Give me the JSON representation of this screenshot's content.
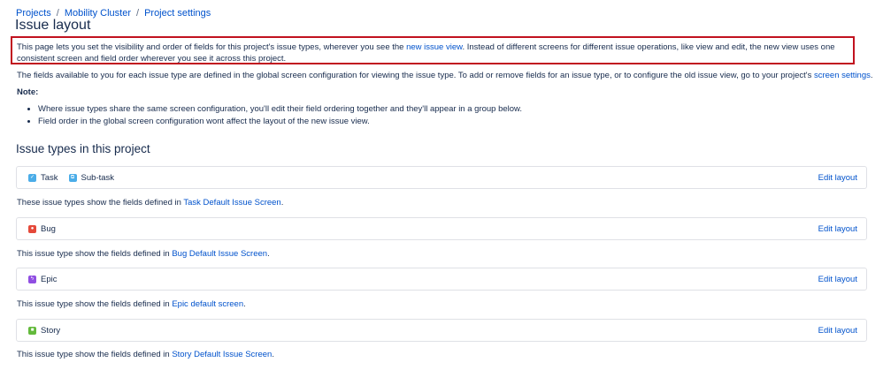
{
  "breadcrumb": {
    "items": [
      "Projects",
      "Mobility Cluster",
      "Project settings"
    ],
    "separator": "/"
  },
  "page_title": "Issue layout",
  "intro": {
    "text_before": "This page lets you set the visibility and order of fields for this project's issue types, wherever you see the ",
    "link": "new issue view",
    "text_after": ". Instead of different screens for different issue operations, like view and edit, the new view uses one consistent screen and field order wherever you see it across this project."
  },
  "fields_para": {
    "text_before": "The fields available to you for each issue type are defined in the global screen configuration for viewing the issue type. To add or remove fields for an issue type, or to configure the old issue view, go to your project's ",
    "link": "screen settings",
    "text_after": "."
  },
  "note_label": "Note:",
  "notes": [
    "Where issue types share the same screen configuration, you'll edit their field ordering together and they'll appear in a group below.",
    "Field order in the global screen configuration wont affect the layout of the new issue view."
  ],
  "section_title": "Issue types in this project",
  "groups": [
    {
      "types": [
        {
          "name": "Task",
          "icon": "task-icon"
        },
        {
          "name": "Sub-task",
          "icon": "subtask-icon"
        }
      ],
      "edit_label": "Edit layout",
      "desc_before": "These issue types show the fields defined in ",
      "screen_link": "Task Default Issue Screen",
      "desc_after": "."
    },
    {
      "types": [
        {
          "name": "Bug",
          "icon": "bug-icon"
        }
      ],
      "edit_label": "Edit layout",
      "desc_before": "This issue type show the fields defined in ",
      "screen_link": "Bug Default Issue Screen",
      "desc_after": "."
    },
    {
      "types": [
        {
          "name": "Epic",
          "icon": "epic-icon"
        }
      ],
      "edit_label": "Edit layout",
      "desc_before": "This issue type show the fields defined in ",
      "screen_link": "Epic default screen",
      "desc_after": "."
    },
    {
      "types": [
        {
          "name": "Story",
          "icon": "story-icon"
        }
      ],
      "edit_label": "Edit layout",
      "desc_before": "This issue type show the fields defined in ",
      "screen_link": "Story Default Issue Screen",
      "desc_after": "."
    }
  ],
  "colors": {
    "link": "#0052cc",
    "text": "#172b4d",
    "highlight_border": "#c1121f",
    "task": "#4bade8",
    "bug": "#e5493a",
    "epic": "#904ee2",
    "story": "#63ba3c"
  }
}
